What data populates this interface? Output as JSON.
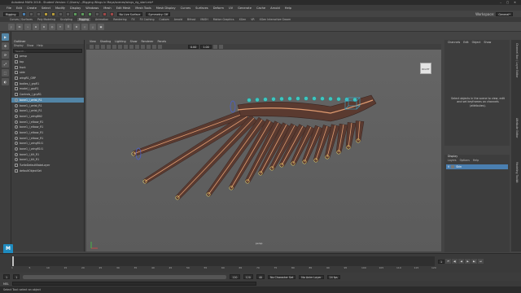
{
  "window": {
    "title": "Autodesk MAYA 2018 - Student Version: C:/Users/.../Rigging Wings in Maya/scenes/wings_rig_start.mb*",
    "controls": [
      "–",
      "▢",
      "✕"
    ]
  },
  "menubar": [
    "File",
    "Edit",
    "Create",
    "Select",
    "Modify",
    "Display",
    "Windows",
    "Mesh",
    "Edit Mesh",
    "Mesh Tools",
    "Mesh Display",
    "Curves",
    "Surfaces",
    "Deform",
    "UV",
    "Generate",
    "Cache",
    "Arnold",
    "Help"
  ],
  "workspace": {
    "label": "Workspace:",
    "value": "General*"
  },
  "status": {
    "mode": "Rigging",
    "surface": "No Live Surface",
    "symmetry": "Symmetry: Off"
  },
  "shelf_tabs": [
    "Curves / Surfaces",
    "Poly Modeling",
    "Sculpting",
    "Rigging",
    "Animation",
    "Rendering",
    "FX",
    "FX Caching",
    "Custom",
    "Arnold",
    "Bifrost",
    "MASH",
    "Motion Graphics",
    "XGen",
    "VR",
    "XGen Interactive Groom"
  ],
  "shelf_active": "Rigging",
  "shelf_icons": [
    "J",
    "IK",
    "⌁",
    "⊕",
    "⊗",
    "◎",
    "✦",
    "☰",
    "⚙",
    "◇",
    "△",
    "▣"
  ],
  "toolbox": [
    "▶",
    "✥",
    "⟳",
    "⤢",
    "⬚",
    "◐"
  ],
  "outliner": {
    "title": "Outliner",
    "menu": [
      "Display",
      "Show",
      "Help"
    ],
    "search": "Search...",
    "rows": [
      {
        "label": "persp",
        "icon": "camera"
      },
      {
        "label": "top",
        "icon": "camera"
      },
      {
        "label": "front",
        "icon": "camera"
      },
      {
        "label": "side",
        "icon": "camera"
      },
      {
        "label": "wingR1_GRP",
        "icon": "group"
      },
      {
        "label": "bodies_l_grpR1",
        "icon": "group"
      },
      {
        "label": "model_l_grpR1",
        "icon": "group"
      },
      {
        "label": "Controls_l_grpR1",
        "icon": "group"
      },
      {
        "label": "bone1_l_wrist_R1",
        "icon": "joint",
        "selected": true
      },
      {
        "label": "bone1_l_wrist_R1",
        "icon": "joint"
      },
      {
        "label": "bone1_l_wrist_R1",
        "icon": "joint"
      },
      {
        "label": "bone1_l_wingBlt2",
        "icon": "joint"
      },
      {
        "label": "bone1_l_elbow_R1",
        "icon": "joint"
      },
      {
        "label": "bone1_l_elbow_R1",
        "icon": "joint"
      },
      {
        "label": "bone1_l_elbow_R1",
        "icon": "joint"
      },
      {
        "label": "bone1_l_elbow_R1",
        "icon": "joint"
      },
      {
        "label": "bone1_l_wingR1t1",
        "icon": "joint"
      },
      {
        "label": "bone1_l_wingR1t1",
        "icon": "joint"
      },
      {
        "label": "bone1_l_tilt_R1",
        "icon": "joint"
      },
      {
        "label": "bone1_l_tilt_R1",
        "icon": "joint"
      },
      {
        "label": "TurtleDefaultBakeLayer",
        "icon": "set"
      },
      {
        "label": "defaultObjectSet",
        "icon": "set"
      }
    ]
  },
  "viewport": {
    "menu": [
      "View",
      "Shading",
      "Lighting",
      "Show",
      "Renderer",
      "Panels"
    ],
    "camera": "persp",
    "viewcube": "RIGHT",
    "field_a": "0.00",
    "field_b": "1.00"
  },
  "channel_box": {
    "tabs": [
      "Channels",
      "Edit",
      "Object",
      "Show"
    ],
    "message": "Select objects in the scene to view, edit and set keyframes on channels (attributes)."
  },
  "layer_editor": {
    "title": "Display",
    "tabs": [
      "Layers",
      "Options",
      "Help"
    ],
    "layer": {
      "visibility": "V",
      "name": "Skin"
    }
  },
  "side_tabs": [
    "Channel Box / Layer Editor",
    "Attribute Editor",
    "Modeling Toolkit"
  ],
  "timeline": {
    "ticks": [
      "1",
      "5",
      "10",
      "15",
      "20",
      "25",
      "30",
      "35",
      "40",
      "45",
      "50",
      "55",
      "60",
      "65",
      "70",
      "75",
      "80",
      "85",
      "90",
      "95",
      "100",
      "105",
      "110",
      "115",
      "120"
    ],
    "current_frame": "1"
  },
  "playback": [
    "⏮",
    "◀|",
    "◀",
    "▶",
    "▶|",
    "⏭"
  ],
  "range": {
    "start": "1",
    "inner_start": "1",
    "inner_end": "120",
    "end": "120",
    "extra": "40",
    "char_set": "No Character Set",
    "anim_layer": "No Anim Layer",
    "fps": "24 fps"
  },
  "cmdline": {
    "label": "MEL"
  },
  "help": "Select Tool: select an object",
  "logo": "M",
  "colors": {
    "accent": "#5285a6",
    "wing": "#5a3a30",
    "bone": "#e09b70",
    "ctrl": "#3fc6c0"
  }
}
